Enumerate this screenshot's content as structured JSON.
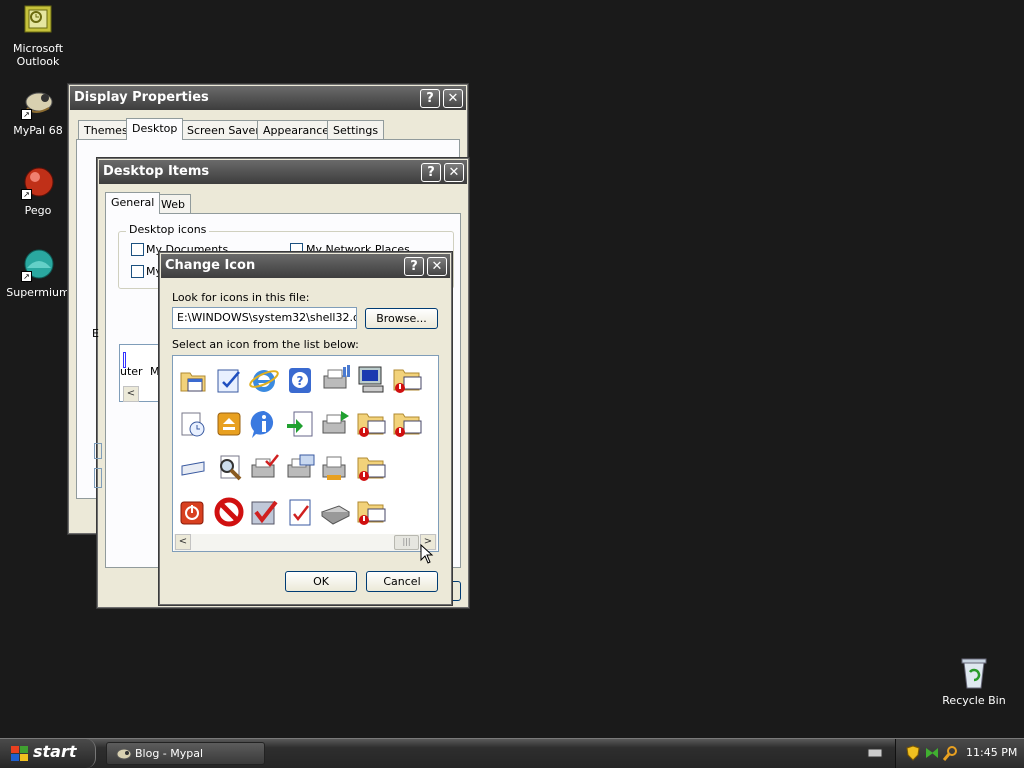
{
  "desktop": {
    "icons": [
      {
        "label": "Microsoft Outlook",
        "icon": "outlook-icon"
      },
      {
        "label": "MyPal 68",
        "icon": "mypal-icon"
      },
      {
        "label": "Pego",
        "icon": "pego-icon"
      },
      {
        "label": "Supermium",
        "icon": "supermium-icon"
      },
      {
        "label": "Recycle Bin",
        "icon": "recycle-bin-icon"
      }
    ]
  },
  "display_properties": {
    "title": "Display Properties",
    "tabs": [
      "Themes",
      "Desktop",
      "Screen Saver",
      "Appearance",
      "Settings"
    ],
    "active_tab": "Desktop"
  },
  "desktop_items": {
    "title": "Desktop Items",
    "tabs": [
      "General",
      "Web"
    ],
    "active_tab": "General",
    "group_label": "Desktop icons",
    "checkboxes": [
      "My Documents",
      "My Network Places",
      "My"
    ],
    "fragments": {
      "e_label": "E",
      "uter": "uter",
      "m": "M"
    }
  },
  "change_icon": {
    "title": "Change Icon",
    "file_label": "Look for icons in this file:",
    "file_value": "E:\\WINDOWS\\system32\\shell32.dll",
    "browse_label": "Browse...",
    "list_label": "Select an icon from the list below:",
    "ok_label": "OK",
    "cancel_label": "Cancel"
  },
  "title_buttons": {
    "help": "?",
    "close": "✕"
  },
  "taskbar": {
    "start_label": "start",
    "task_label": "Blog - Mypal",
    "clock": "11:45 PM"
  },
  "colors": {
    "desktop_bg": "#1a1a1a",
    "start_green": "#3c8a3c",
    "titlebar_dark": "#3d3d3d"
  }
}
